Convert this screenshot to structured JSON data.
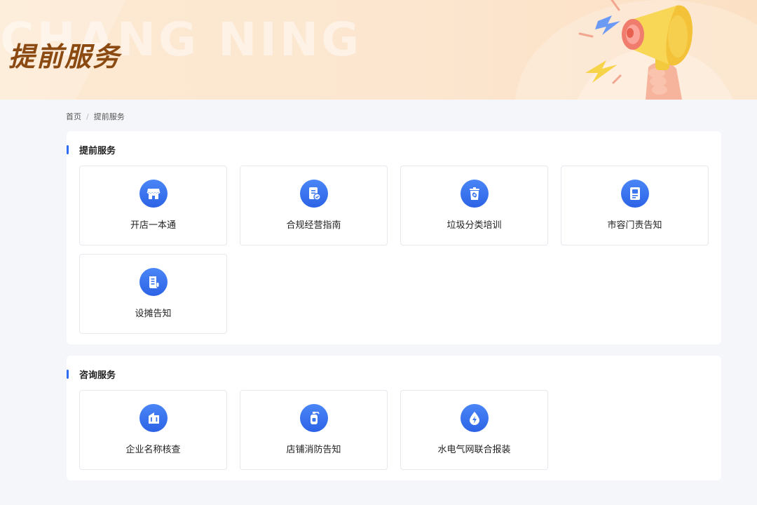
{
  "banner": {
    "bg_text": "CHANG NING",
    "title": "提前服务"
  },
  "breadcrumb": {
    "home": "首页",
    "separator": "/",
    "current": "提前服务"
  },
  "sections": [
    {
      "title": "提前服务",
      "items": [
        {
          "label": "开店一本通",
          "icon": "storefront-icon"
        },
        {
          "label": "合规经营指南",
          "icon": "document-check-icon"
        },
        {
          "label": "垃圾分类培训",
          "icon": "trash-bin-icon"
        },
        {
          "label": "市容门责告知",
          "icon": "notice-board-icon"
        },
        {
          "label": "设摊告知",
          "icon": "scroll-icon"
        }
      ]
    },
    {
      "title": "咨询服务",
      "items": [
        {
          "label": "企业名称核查",
          "icon": "building-icon"
        },
        {
          "label": "店铺消防告知",
          "icon": "fire-extinguisher-icon"
        },
        {
          "label": "水电气网联合报装",
          "icon": "utility-drop-icon"
        }
      ]
    }
  ],
  "colors": {
    "accent": "#2f6bf0",
    "banner_title": "#8a4a12",
    "page_bg": "#f4f6f9"
  }
}
